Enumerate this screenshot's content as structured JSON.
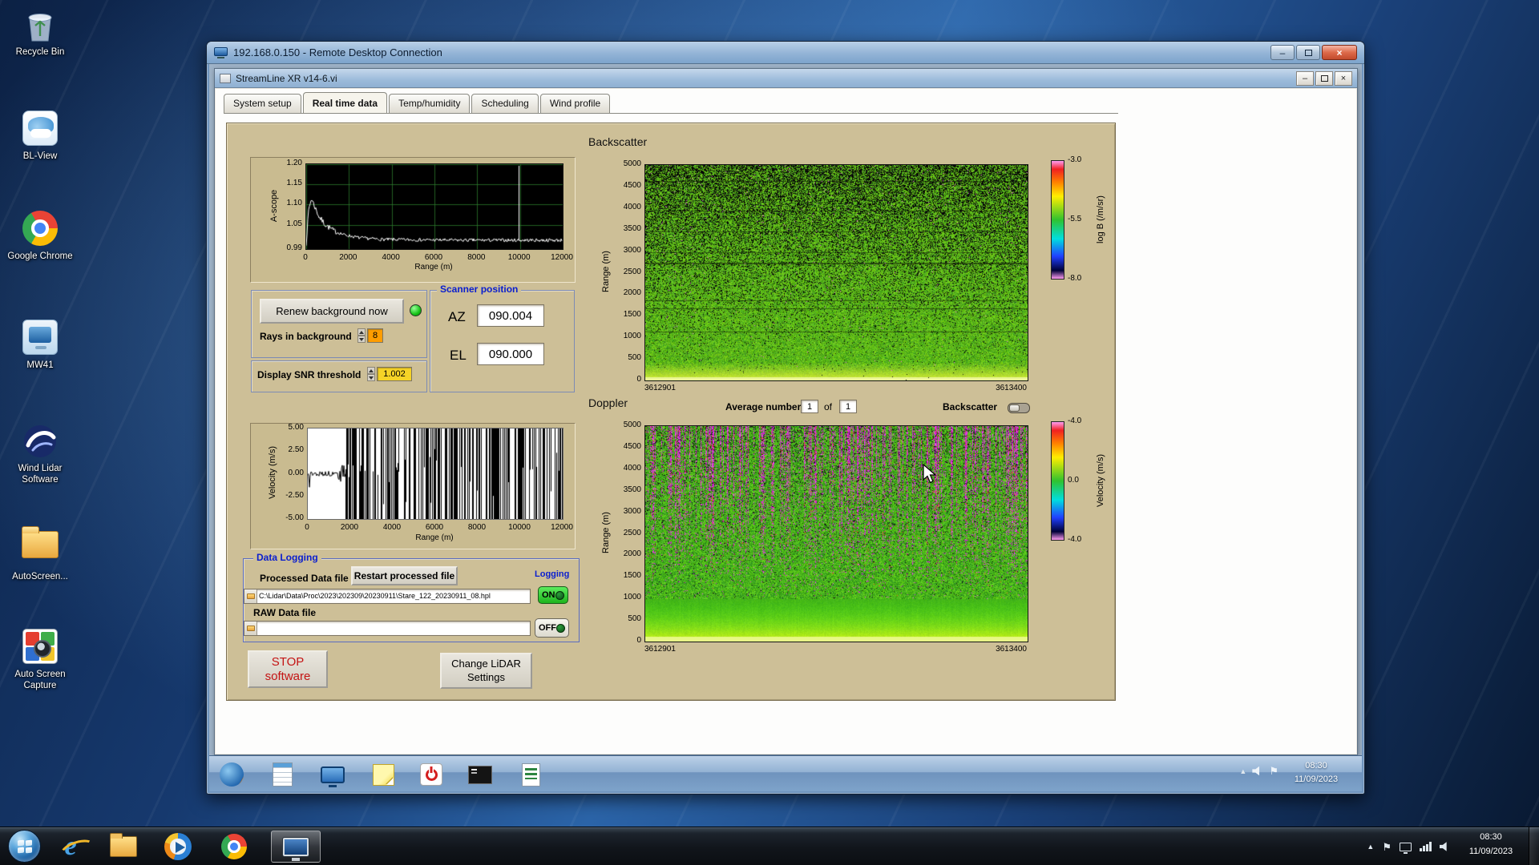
{
  "desktop": {
    "icons": [
      {
        "label": "Recycle Bin"
      },
      {
        "label": "BL-View"
      },
      {
        "label": "Google Chrome"
      },
      {
        "label": "MW41"
      },
      {
        "label": "Wind Lidar Software"
      },
      {
        "label": "AutoScreen..."
      },
      {
        "label": "Auto Screen Capture"
      }
    ]
  },
  "rdp": {
    "title": "192.168.0.150 - Remote Desktop Connection"
  },
  "vi": {
    "title": "StreamLine XR v14-6.vi",
    "tabs": [
      {
        "label": "System setup"
      },
      {
        "label": "Real time data"
      },
      {
        "label": "Temp/humidity"
      },
      {
        "label": "Scheduling"
      },
      {
        "label": "Wind profile"
      }
    ]
  },
  "controls": {
    "renew_button": "Renew background now",
    "rays_label": "Rays in background",
    "rays_value": "8",
    "snr_label": "Display SNR threshold",
    "snr_value": "1.002",
    "scanner_title": "Scanner position",
    "az_label": "AZ",
    "az_value": "090.004",
    "el_label": "EL",
    "el_value": "090.000",
    "average_label": "Average number",
    "average_value": "1",
    "average_of": "of",
    "average_total": "1",
    "backscatter_switch_label": "Backscatter",
    "logging_title": "Data Logging",
    "processed_label": "Processed Data file",
    "restart_button": "Restart processed file",
    "logging_label": "Logging",
    "processed_path": "C:\\Lidar\\Data\\Proc\\2023\\202309\\20230911\\Stare_122_20230911_08.hpl",
    "on_label": "ON",
    "raw_label": "RAW Data file",
    "raw_path": "",
    "off_label": "OFF",
    "stop_line1": "STOP",
    "stop_line2": "software",
    "change_line1": "Change LiDAR",
    "change_line2": "Settings"
  },
  "chart_data": [
    {
      "id": "ascope",
      "type": "line",
      "title": "",
      "xlabel": "Range (m)",
      "ylabel": "A-scope",
      "xlim": [
        0,
        12000
      ],
      "ylim": [
        0.99,
        1.2
      ],
      "xticks": [
        0,
        2000,
        4000,
        6000,
        8000,
        10000,
        12000
      ],
      "yticks": [
        1.2,
        1.15,
        1.1,
        1.05,
        0.99
      ],
      "ytick_labels": [
        "1.20",
        "1.15",
        "1.10",
        "1.05",
        "0.99"
      ],
      "series": [
        {
          "name": "a-scope",
          "x": [
            0,
            120,
            250,
            400,
            600,
            900,
            1300,
            1800,
            2500,
            3500,
            5000,
            7000,
            9000,
            11000,
            12000
          ],
          "y": [
            1.005,
            1.09,
            1.115,
            1.095,
            1.07,
            1.05,
            1.035,
            1.025,
            1.018,
            1.014,
            1.013,
            1.012,
            1.012,
            1.012,
            1.012
          ]
        }
      ],
      "annotations": [
        {
          "type": "vline",
          "x": 9950
        }
      ],
      "noise_amp": 0.004,
      "bg": "#000000",
      "grid": true,
      "line_color": "#ffffff"
    },
    {
      "id": "velocity",
      "type": "line",
      "title": "",
      "xlabel": "Range (m)",
      "ylabel": "Velocity (m/s)",
      "xlim": [
        0,
        12000
      ],
      "ylim": [
        -5,
        5
      ],
      "xticks": [
        0,
        2000,
        4000,
        6000,
        8000,
        10000,
        12000
      ],
      "yticks": [
        5.0,
        2.5,
        0.0,
        -2.5,
        -5.0
      ],
      "ytick_labels": [
        "5.00",
        "2.50",
        "0.00",
        "-2.50",
        "-5.00"
      ],
      "description": "velocity near 0 m/s for range < 1800 m, saturated full-scale noise bars beyond",
      "noise_start_range": 1800,
      "bar_density": 0.52,
      "bg": "#ffffff",
      "line_color": "#000000"
    },
    {
      "id": "backscatter",
      "type": "heatmap",
      "title": "Backscatter",
      "ylabel": "Range (m)",
      "ylim": [
        0,
        5000
      ],
      "yticks": [
        5000,
        4500,
        4000,
        3500,
        3000,
        2500,
        2000,
        1500,
        1000,
        500,
        0
      ],
      "xtick_labels": [
        "3612901",
        "3613400"
      ],
      "colorbar": {
        "label": "log B (/m/sr)",
        "ticks": [
          "-3.0",
          "-5.5",
          "-8.0"
        ]
      },
      "description": "speckled green field near -5.5 with black dropout noise increasing with range; bright yellow-green band below ~400 m"
    },
    {
      "id": "doppler",
      "type": "heatmap",
      "title": "Doppler",
      "ylabel": "Range (m)",
      "ylim": [
        0,
        5000
      ],
      "yticks": [
        5000,
        4500,
        4000,
        3500,
        3000,
        2500,
        2000,
        1500,
        1000,
        500,
        0
      ],
      "xtick_labels": [
        "3612901",
        "3613400"
      ],
      "colorbar": {
        "label": "Velocity (m/s)",
        "ticks": [
          "-4.0",
          "0.0",
          "-4.0"
        ]
      },
      "description": "green ~0 m/s field with vertical magenta noise streaks above ~1200 m; smooth yellow-green band near the surface"
    }
  ],
  "session_taskbar": {
    "time": "08:30",
    "date": "11/09/2023"
  },
  "taskbar": {
    "time": "08:30",
    "date": "11/09/2023",
    "ie_glyph": "e"
  }
}
